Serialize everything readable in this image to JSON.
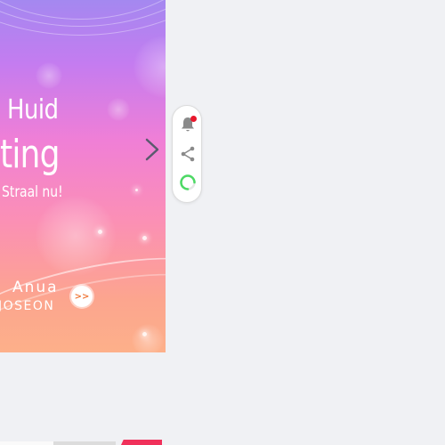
{
  "banner": {
    "headline_line1": "Huid",
    "headline_line2": "ting",
    "subline": "Straal nu!",
    "brand_line1": "Anua",
    "brand_line2": "JOSEON",
    "cta_label": ">>",
    "next_icon": "chevron-right-icon"
  },
  "toolbar": {
    "notification_icon": "bell-icon",
    "notification_badge_color": "#e8172c",
    "share_icon": "share-icon",
    "loading_icon": "loading-spinner-icon",
    "loading_color": "#4cd964"
  },
  "colors": {
    "page_background": "#f0f1f4",
    "icon_grey": "#8a8a8a",
    "promo_red": "#f0305a"
  }
}
